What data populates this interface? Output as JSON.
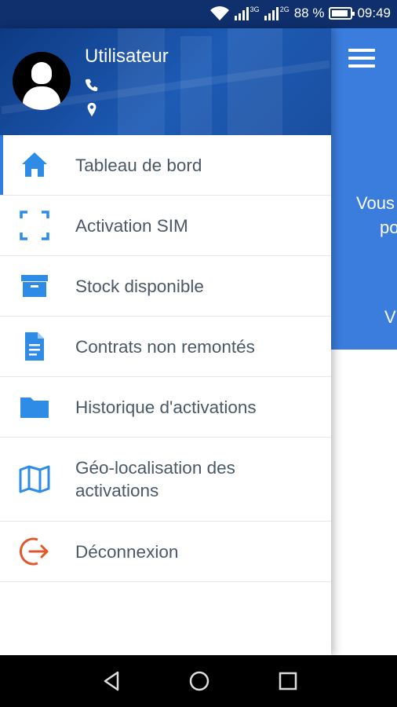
{
  "status_bar": {
    "net1": "3G",
    "net2": "2G",
    "battery": "88 %",
    "battery_level": 0.88,
    "time": "09:49"
  },
  "drawer": {
    "username": "Utilisateur",
    "phone_icon": "phone-icon",
    "location_icon": "location-pin-icon",
    "items": [
      {
        "label": "Tableau de bord",
        "icon": "home-icon",
        "active": true,
        "color": "#2e8be6"
      },
      {
        "label": "Activation SIM",
        "icon": "scan-frame-icon",
        "active": false,
        "color": "#2e8be6"
      },
      {
        "label": "Stock disponible",
        "icon": "archive-box-icon",
        "active": false,
        "color": "#2e8be6"
      },
      {
        "label": "Contrats non remontés",
        "icon": "document-icon",
        "active": false,
        "color": "#2e8be6"
      },
      {
        "label": "Historique d'activations",
        "icon": "folder-icon",
        "active": false,
        "color": "#2e8be6"
      },
      {
        "label": "Géo-localisation des activations",
        "icon": "map-icon",
        "active": false,
        "color": "#2e8be6"
      },
      {
        "label": "Déconnexion",
        "icon": "logout-icon",
        "active": false,
        "color": "#e2572a"
      }
    ]
  },
  "background_app": {
    "menu_icon": "hamburger-icon",
    "text_line1": "Vous",
    "text_line2": "po",
    "text_line3": "V",
    "accent": "#3a7ddd"
  },
  "nav_bar": {
    "back": "back-icon",
    "home": "home-circle-icon",
    "recents": "recents-icon"
  }
}
